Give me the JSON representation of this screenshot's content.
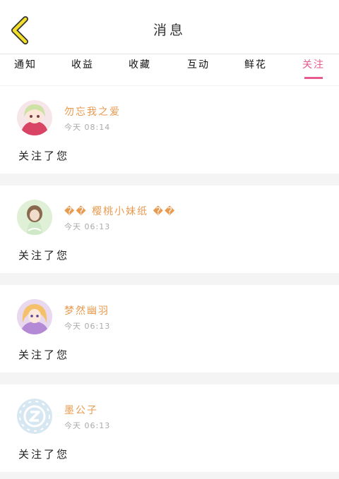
{
  "header": {
    "title": "消息",
    "back_icon": "chevron-left-icon"
  },
  "tabs": [
    {
      "label": "通知"
    },
    {
      "label": "收益"
    },
    {
      "label": "收藏"
    },
    {
      "label": "互动"
    },
    {
      "label": "鲜花"
    },
    {
      "label": "关注",
      "active": true
    }
  ],
  "messages": [
    {
      "name": "勿忘我之爱",
      "time": "今天 08:14",
      "action": "关注了您",
      "avatar": "anime-girl-avatar"
    },
    {
      "name": "�� 樱桃小妹纸 ��",
      "time": "今天 06:13",
      "action": "关注了您",
      "avatar": "girl-photo-avatar"
    },
    {
      "name": "梦然幽羽",
      "time": "今天 06:13",
      "action": "关注了您",
      "avatar": "anime-girl-avatar"
    },
    {
      "name": "墨公子",
      "time": "今天 06:13",
      "action": "关注了您",
      "avatar": "default-z-avatar"
    }
  ],
  "colors": {
    "accent": "#e65a8e",
    "name": "#e89a50",
    "back_icon": "#f2df2a"
  }
}
